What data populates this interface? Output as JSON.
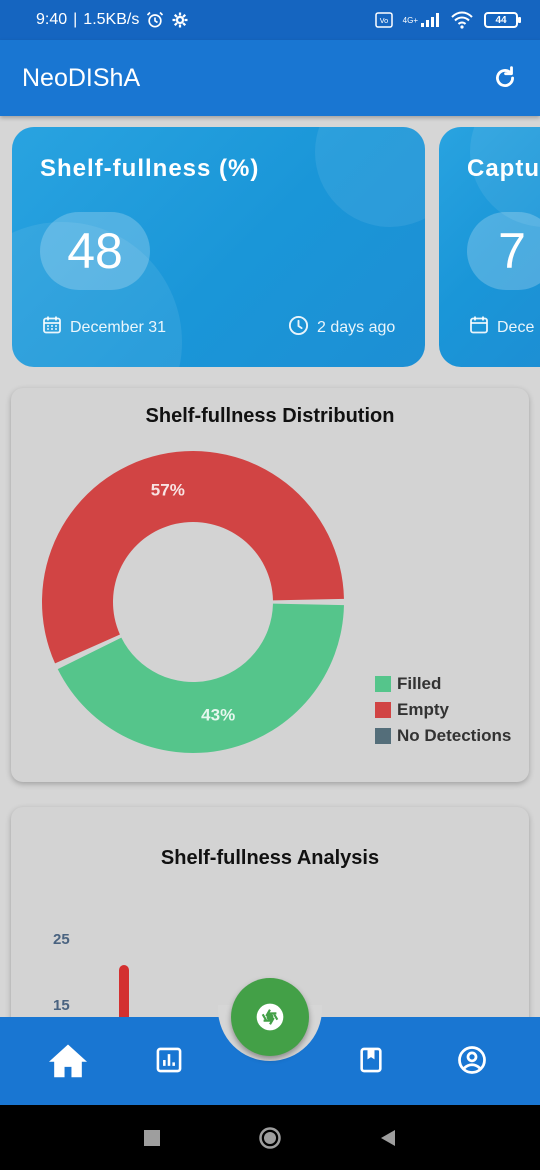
{
  "status_bar": {
    "time": "9:40",
    "speed": "1.5KB/s",
    "network": "4G+",
    "battery": "44"
  },
  "app_bar": {
    "title": "NeoDIShA",
    "refresh_icon": "refresh-icon"
  },
  "stat_cards": [
    {
      "title": "Shelf-fullness (%)",
      "value": "48",
      "date": "December 31",
      "ago": "2 days ago"
    },
    {
      "title": "Captu",
      "value": "7",
      "date": "Dece"
    }
  ],
  "distribution": {
    "title": "Shelf-fullness Distribution",
    "legend": [
      {
        "label": "Filled",
        "color": "#55c58b"
      },
      {
        "label": "Empty",
        "color": "#d14444"
      },
      {
        "label": "No Detections",
        "color": "#546e7a"
      }
    ],
    "chart_data": {
      "type": "pie",
      "categories": [
        "Empty",
        "Filled"
      ],
      "values": [
        57,
        43
      ],
      "labels": [
        "57%",
        "43%"
      ],
      "colors": [
        "#d14444",
        "#55c58b"
      ]
    }
  },
  "analysis": {
    "title": "Shelf-fullness Analysis",
    "y_ticks": [
      "25",
      "15"
    ]
  },
  "bottom_nav": {
    "items": [
      "home-icon",
      "chart-icon",
      "camera-icon",
      "bookmark-icon",
      "account-icon"
    ]
  }
}
